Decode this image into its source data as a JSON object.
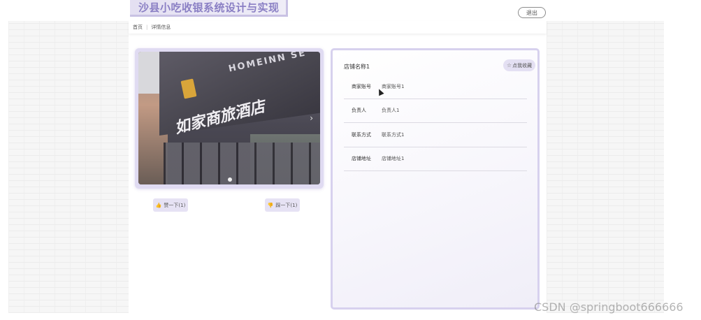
{
  "header": {
    "title": "沙县小吃收银系统设计与实现",
    "logout_label": "退出"
  },
  "breadcrumb": {
    "home": "首页",
    "current": "详情信息"
  },
  "gallery": {
    "sign_en": "HOMEINN SE",
    "sign_cn": "如家商旅酒店",
    "next_arrow": "›"
  },
  "actions": {
    "like_label": "赞一下(1)",
    "dislike_label": "踩一下(1)",
    "like_icon": "thumbs-up-icon",
    "dislike_icon": "thumbs-down-icon"
  },
  "shop": {
    "name": "店铺名称1",
    "favorite_label": "点我收藏",
    "fields": [
      {
        "label": "商家账号",
        "value": "商家账号1"
      },
      {
        "label": "负责人",
        "value": "负责人1"
      },
      {
        "label": "联系方式",
        "value": "联系方式1"
      },
      {
        "label": "店铺地址",
        "value": "店铺地址1"
      }
    ]
  },
  "watermark": "CSDN @springboot666666"
}
